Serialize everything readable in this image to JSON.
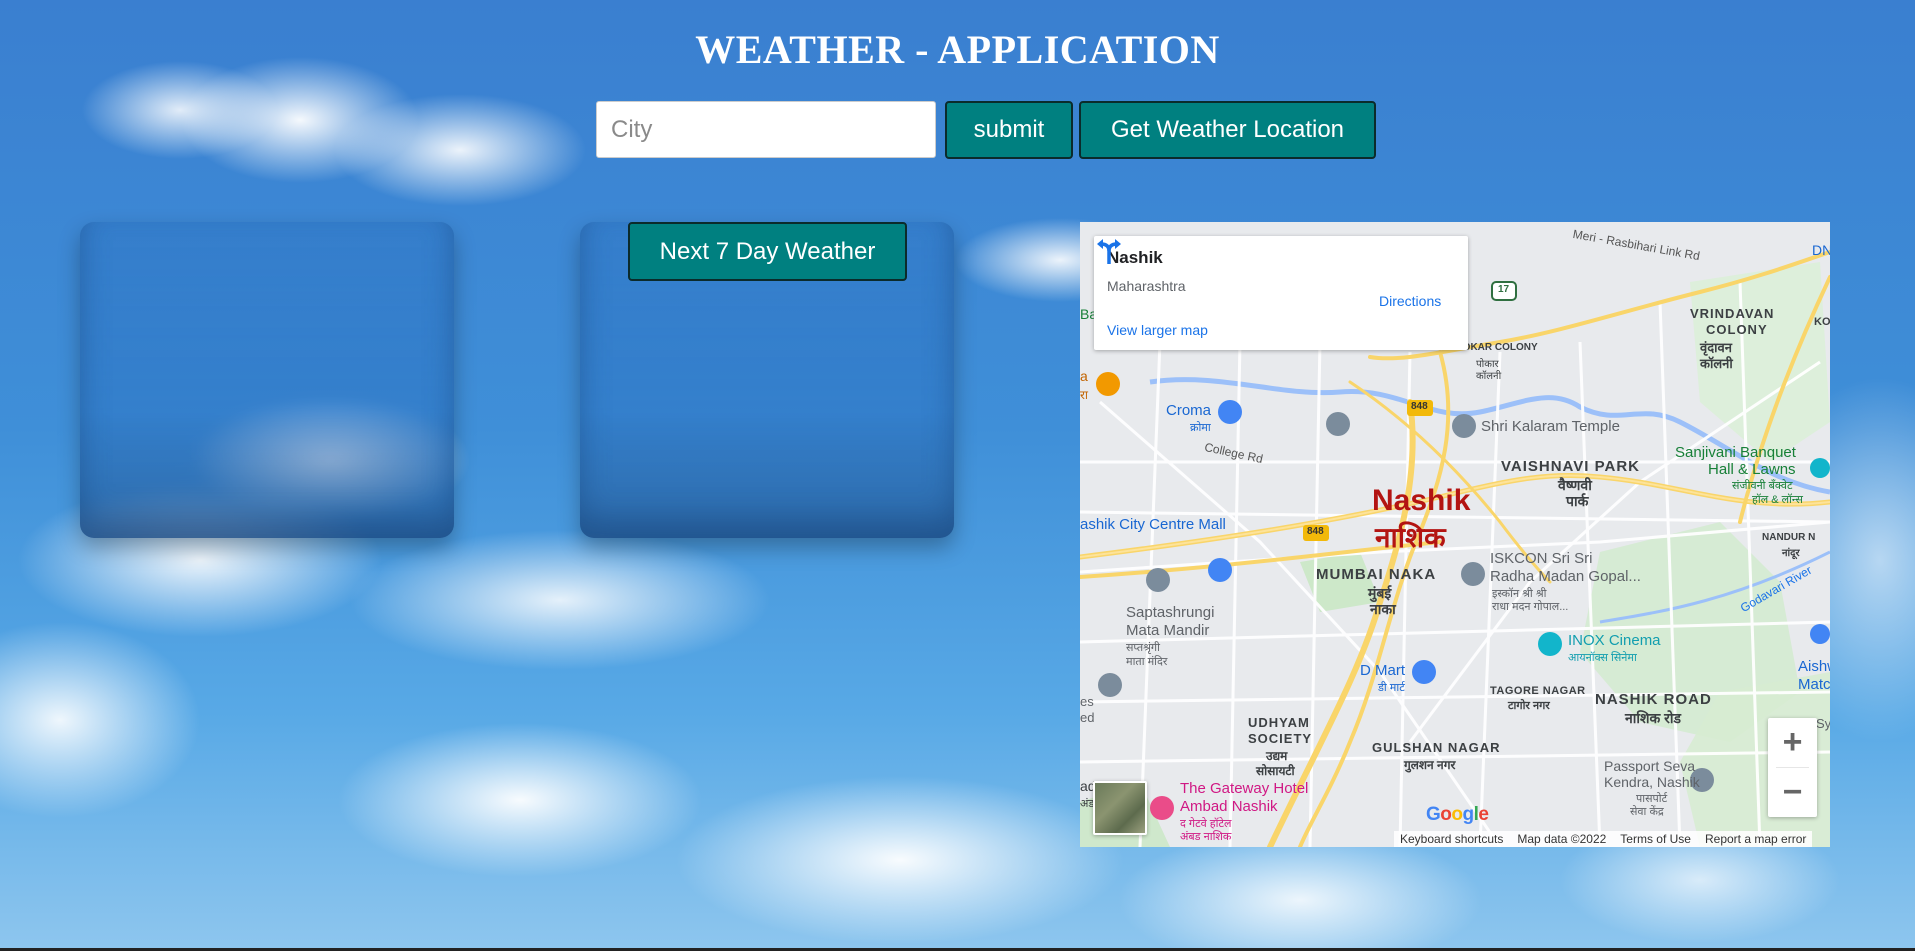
{
  "app": {
    "title": "WEATHER - APPLICATION"
  },
  "search": {
    "placeholder": "City",
    "value": "",
    "submit_label": "submit",
    "location_label": "Get Weather Location"
  },
  "forecast": {
    "next_label": "Next 7 Day Weather"
  },
  "map": {
    "info": {
      "name": "Nashik",
      "state": "Maharashtra",
      "directions_label": "Directions",
      "larger_map_label": "View larger map"
    },
    "labels": {
      "city_en": "Nashik",
      "city_mr": "नाशिक",
      "croma_en": "Croma",
      "croma_mr": "क्रोमा",
      "college_rd": "College Rd",
      "kalaram": "Shri Kalaram Temple",
      "vaishnavi_en": "VAISHNAVI PARK",
      "vaishnavi_mr1": "वैष्णवी",
      "vaishnavi_mr2": "पार्क",
      "vrindavan1": "VRINDAVAN",
      "vrindavan2": "COLONY",
      "vrindavan_mr1": "वृंदावन",
      "vrindavan_mr2": "कॉलनी",
      "sanjivani1": "Sanjivani Banquet",
      "sanjivani2": "Hall & Lawns",
      "sanjivani_mr1": "संजीवनी बँक्वेट",
      "sanjivani_mr2": "हॉल & लॉन्स",
      "nashik_city_centre": "ashik City Centre Mall",
      "mumbai_naka_en": "MUMBAI NAKA",
      "mumbai_naka_mr1": "मुंबई",
      "mumbai_naka_mr2": "नाका",
      "iskcon1": "ISKCON Sri Sri",
      "iskcon2": "Radha Madan Gopal...",
      "iskcon_mr1": "इस्कॉन श्री श्री",
      "iskcon_mr2": "राधा मदन गोपाल...",
      "saptashrungi1": "Saptashrungi",
      "saptashrungi2": "Mata Mandir",
      "saptashrungi_mr1": "सप्तश्रृंगी",
      "saptashrungi_mr2": "माता मंदिर",
      "inox_en": "INOX Cinema",
      "inox_mr": "आयनॉक्स सिनेमा",
      "dmart_en": "D Mart",
      "dmart_mr": "डी मार्ट",
      "tagore_en": "TAGORE NAGAR",
      "tagore_mr": "टागोर नगर",
      "nashik_road_en": "NASHIK ROAD",
      "nashik_road_mr": "नाशिक रोड",
      "udhyam1": "UDHYAM",
      "udhyam2": "SOCIETY",
      "udhyam_mr1": "उद्यम",
      "udhyam_mr2": "सोसायटी",
      "gulshan_en": "GULSHAN NAGAR",
      "gulshan_mr": "गुलशन नगर",
      "passport1": "Passport Seva",
      "passport2": "Kendra, Nashik",
      "passport_mr1": "पासपोर्ट",
      "passport_mr2": "सेवा केंद्र",
      "gateway1": "The Gateway Hotel",
      "gateway2": "Ambad Nashik",
      "gateway_mr1": "द गेटवे हॉटेल",
      "gateway_mr2": "अंबड नाशिक",
      "meri_rd": "Meri - Rasbihari Link Rd",
      "godavari": "Godavari River",
      "nandur1": "NANDUR N",
      "nandur_mr": "नांदूर",
      "pokar1": "पोकार",
      "pokar2": "कॉलनी",
      "pokar_colony": "POKAR COLONY",
      "aishw1": "Aishw",
      "aishw2": "Matc",
      "route_848": "848",
      "route_17": "17",
      "dn": "DN",
      "ko": "KO",
      "ba": "Ba",
      "a": "a",
      "ra": "रा",
      "es": "es",
      "ed": "ed",
      "ad_gaon": "ad Gaon",
      "ad_mr": "अंड",
      "syd": "Sy"
    },
    "attribution": {
      "keyboard": "Keyboard shortcuts",
      "map_data": "Map data ©2022",
      "terms": "Terms of Use",
      "report": "Report a map error"
    },
    "google": "Google",
    "zoom_in": "+",
    "zoom_out": "−"
  },
  "colors": {
    "button_bg": "#008080",
    "link": "#1a73e8",
    "city_label": "#b31412"
  }
}
